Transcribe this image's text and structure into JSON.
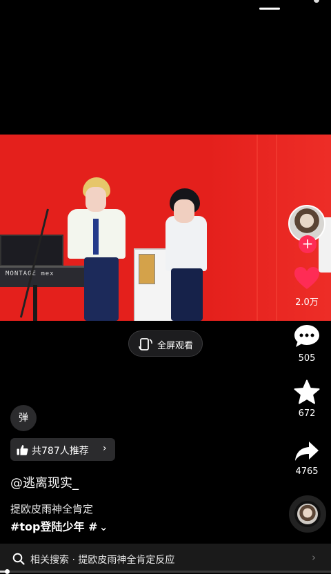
{
  "video": {
    "keyboard_brand": "MONTAGE mex"
  },
  "actions": {
    "like_count": "2.0万",
    "comment_count": "505",
    "favorite_count": "672",
    "share_count": "4765"
  },
  "fullscreen": {
    "label": "全屏观看"
  },
  "danmu": {
    "label": "弹"
  },
  "recommend": {
    "label": "共787人推荐",
    "arrow": "›"
  },
  "post": {
    "author": "@逃离现实_",
    "caption": "提欧皮雨神全肯定",
    "hashtags": "#top登陆少年 #",
    "expand_icon": "⌄"
  },
  "search": {
    "label": "相关搜索 · 提欧皮雨神全肯定反应",
    "arrow": "›"
  },
  "playback": {
    "progress": 0.02
  },
  "colors": {
    "accent": "#fe2c55",
    "like": "#fe2c55",
    "stage": "#e4201c",
    "background": "#000000"
  },
  "icons": {
    "like": "heart-icon",
    "comment": "comment-bubble-icon",
    "favorite": "star-icon",
    "share": "share-arrow-icon",
    "follow": "plus-icon",
    "fullscreen": "fullscreen-rotate-icon",
    "recommend": "thumbs-up-icon",
    "search": "search-icon"
  }
}
